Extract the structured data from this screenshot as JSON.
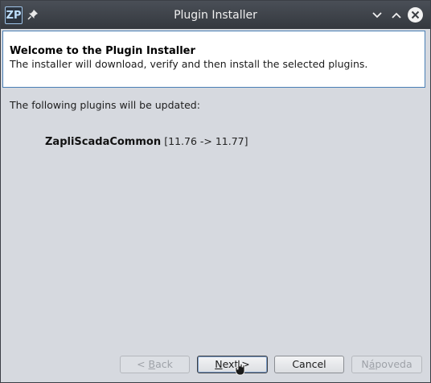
{
  "window": {
    "title": "Plugin Installer",
    "app_logo_text": "ZP"
  },
  "header": {
    "title": "Welcome to the Plugin Installer",
    "description": "The installer will download, verify and then install the selected plugins."
  },
  "content": {
    "intro": "The following plugins will be updated:",
    "plugins": [
      {
        "name": "ZapliScadaCommon",
        "version_change": "[11.76 -> 11.77]"
      }
    ]
  },
  "buttons": {
    "back_prefix": "< ",
    "back_mnemonic": "B",
    "back_rest": "ack",
    "next_mnemonic": "N",
    "next_rest": "ext >",
    "cancel": "Cancel",
    "help_prefix": "N",
    "help_mnemonic": "á",
    "help_rest": "poveda"
  },
  "colors": {
    "titlebar": "#3d4148",
    "panel_bg": "#d6d9df",
    "header_border": "#4a7fb5"
  },
  "icons": [
    "app-logo-icon",
    "pin-icon",
    "chevron-down-icon",
    "chevron-up-icon",
    "close-icon",
    "mouse-cursor-icon"
  ]
}
